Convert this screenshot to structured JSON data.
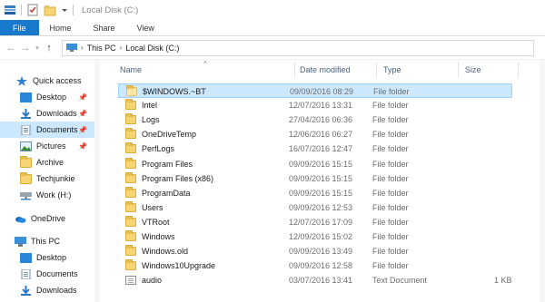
{
  "window": {
    "title": "Local Disk (C:)"
  },
  "ribbon": {
    "tabs": [
      {
        "label": "File"
      },
      {
        "label": "Home"
      },
      {
        "label": "Share"
      },
      {
        "label": "View"
      }
    ]
  },
  "address": {
    "crumbs": [
      "This PC",
      "Local Disk (C:)"
    ]
  },
  "nav": {
    "quick_access": "Quick access",
    "items": [
      {
        "label": "Desktop",
        "icon": "desktop-icon",
        "pinned": true
      },
      {
        "label": "Downloads",
        "icon": "download-icon",
        "pinned": true
      },
      {
        "label": "Documents",
        "icon": "documents-icon",
        "pinned": true,
        "selected": true
      },
      {
        "label": "Pictures",
        "icon": "pictures-icon",
        "pinned": true
      },
      {
        "label": "Archive",
        "icon": "folder-icon"
      },
      {
        "label": "Techjunkie",
        "icon": "folder-icon"
      },
      {
        "label": "Work (H:)",
        "icon": "network-drive-icon"
      }
    ],
    "onedrive": "OneDrive",
    "this_pc": "This PC",
    "pc_items": [
      {
        "label": "Desktop",
        "icon": "desktop-icon"
      },
      {
        "label": "Documents",
        "icon": "documents-icon"
      },
      {
        "label": "Downloads",
        "icon": "download-icon"
      }
    ]
  },
  "columns": {
    "name": "Name",
    "date": "Date modified",
    "type": "Type",
    "size": "Size"
  },
  "files": [
    {
      "name": "$WINDOWS.~BT",
      "date": "09/09/2016 08:29",
      "type": "File folder",
      "size": "",
      "kind": "folder",
      "selected": true
    },
    {
      "name": "Intel",
      "date": "12/07/2016 13:31",
      "type": "File folder",
      "size": "",
      "kind": "folder"
    },
    {
      "name": "Logs",
      "date": "27/04/2016 06:36",
      "type": "File folder",
      "size": "",
      "kind": "folder"
    },
    {
      "name": "OneDriveTemp",
      "date": "12/06/2016 06:27",
      "type": "File folder",
      "size": "",
      "kind": "folder"
    },
    {
      "name": "PerfLogs",
      "date": "16/07/2016 12:47",
      "type": "File folder",
      "size": "",
      "kind": "folder"
    },
    {
      "name": "Program Files",
      "date": "09/09/2016 15:15",
      "type": "File folder",
      "size": "",
      "kind": "folder"
    },
    {
      "name": "Program Files (x86)",
      "date": "09/09/2016 15:15",
      "type": "File folder",
      "size": "",
      "kind": "folder"
    },
    {
      "name": "ProgramData",
      "date": "09/09/2016 15:15",
      "type": "File folder",
      "size": "",
      "kind": "folder"
    },
    {
      "name": "Users",
      "date": "09/09/2016 12:53",
      "type": "File folder",
      "size": "",
      "kind": "folder"
    },
    {
      "name": "VTRoot",
      "date": "12/07/2016 17:09",
      "type": "File folder",
      "size": "",
      "kind": "folder"
    },
    {
      "name": "Windows",
      "date": "12/09/2016 15:02",
      "type": "File folder",
      "size": "",
      "kind": "folder"
    },
    {
      "name": "Windows.old",
      "date": "09/09/2016 13:49",
      "type": "File folder",
      "size": "",
      "kind": "folder"
    },
    {
      "name": "Windows10Upgrade",
      "date": "09/09/2016 12:58",
      "type": "File folder",
      "size": "",
      "kind": "folder"
    },
    {
      "name": "audio",
      "date": "03/07/2016 13:41",
      "type": "Text Document",
      "size": "1 KB",
      "kind": "file"
    }
  ],
  "colors": {
    "accent": "#1979ca",
    "selection": "#cce8ff",
    "folder": "#f6d473"
  }
}
